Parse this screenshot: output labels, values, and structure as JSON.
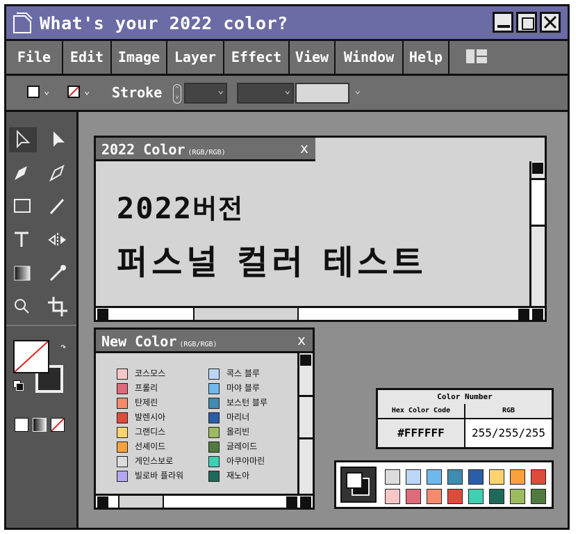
{
  "window": {
    "title": "What's your 2022 color?"
  },
  "menu": [
    "File",
    "Edit",
    "Image",
    "Layer",
    "Effect",
    "View",
    "Window",
    "Help"
  ],
  "options": {
    "stroke_label": "Stroke"
  },
  "main_window": {
    "title": "2022 Color",
    "title_sub": "(RGB/RGB)",
    "line1_num": "2022",
    "line1_kor": "버전",
    "line2": "퍼스널 컬러 테스트",
    "close": "x"
  },
  "new_color": {
    "title": "New Color",
    "title_sub": "(RGB/RGB)",
    "close": "x",
    "items_left": [
      {
        "label": "코스모스",
        "color": "#f7c7c7"
      },
      {
        "label": "프롤리",
        "color": "#dd6b7c"
      },
      {
        "label": "탄제린",
        "color": "#f58b6c"
      },
      {
        "label": "발렌시아",
        "color": "#dd4b3b"
      },
      {
        "label": "그랜디스",
        "color": "#fdd36f"
      },
      {
        "label": "선셰이드",
        "color": "#f9a23d"
      },
      {
        "label": "게인스보로",
        "color": "#dcdcdc"
      },
      {
        "label": "빌로바 플라워",
        "color": "#b7a6f2"
      }
    ],
    "items_right": [
      {
        "label": "콕스 블루",
        "color": "#bcd6f8"
      },
      {
        "label": "마야 블루",
        "color": "#6fb8ee"
      },
      {
        "label": "보스턴 블루",
        "color": "#3f8bb1"
      },
      {
        "label": "마리너",
        "color": "#2b5ea8"
      },
      {
        "label": "올리빈",
        "color": "#9cbb5e"
      },
      {
        "label": "글레이드",
        "color": "#4f7b3f"
      },
      {
        "label": "아쿠아마린",
        "color": "#3fcfb3"
      },
      {
        "label": "재노아",
        "color": "#1e6a59"
      }
    ]
  },
  "color_number": {
    "title": "Color Number",
    "hex_header": "Hex Color Code",
    "rgb_header": "RGB",
    "hex": "#FFFFFF",
    "rgb": "255/255/255"
  },
  "palette": {
    "top": [
      "#dcdcdc",
      "#bcd6f8",
      "#6fb8ee",
      "#3f8bb1",
      "#2b5ea8",
      "#fdd36f",
      "#f9a23d",
      "#dd4b3b"
    ],
    "bottom": [
      "#f7c7c7",
      "#dd6b7c",
      "#f58b6c",
      "#dd4b3b",
      "#3fcfb3",
      "#1e6a59",
      "#9cbb5e",
      "#4f7b3f"
    ]
  }
}
